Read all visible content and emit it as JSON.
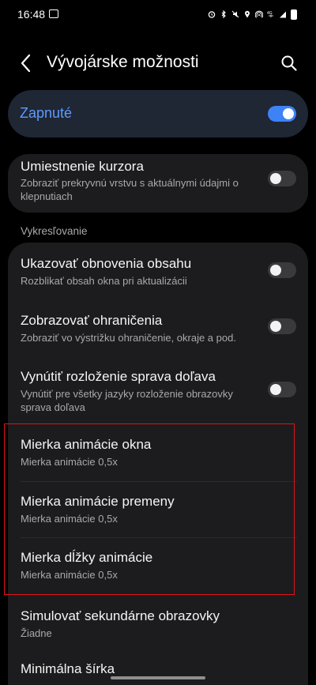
{
  "status": {
    "time": "16:48"
  },
  "appbar": {
    "title": "Vývojárske možnosti"
  },
  "master": {
    "label": "Zapnuté",
    "on": true
  },
  "cursor": {
    "title": "Umiestnenie kurzora",
    "subtitle": "Zobraziť prekryvnú vrstvu s aktuálnymi údajmi o klepnutiach"
  },
  "section": {
    "label": "Vykresľovanie"
  },
  "drawing": [
    {
      "title": "Ukazovať obnovenia obsahu",
      "subtitle": "Rozblikať obsah okna pri aktualizácii"
    },
    {
      "title": "Zobrazovať ohraničenia",
      "subtitle": "Zobraziť vo výstrižku ohraničenie, okraje a pod."
    },
    {
      "title": "Vynútiť rozloženie sprava doľava",
      "subtitle": "Vynútiť pre všetky jazyky rozloženie obrazovky sprava doľava"
    },
    {
      "title": "Mierka animácie okna",
      "subtitle": "Mierka animácie 0,5x"
    },
    {
      "title": "Mierka animácie premeny",
      "subtitle": "Mierka animácie 0,5x"
    },
    {
      "title": "Mierka dĺžky animácie",
      "subtitle": "Mierka animácie 0,5x"
    },
    {
      "title": "Simulovať sekundárne obrazovky",
      "subtitle": "Žiadne"
    },
    {
      "title": "Minimálna šírka",
      "subtitle": ""
    }
  ],
  "colors": {
    "accent": "#3e82f7",
    "highlight": "#e0141a",
    "card": "#1c1c1e"
  }
}
